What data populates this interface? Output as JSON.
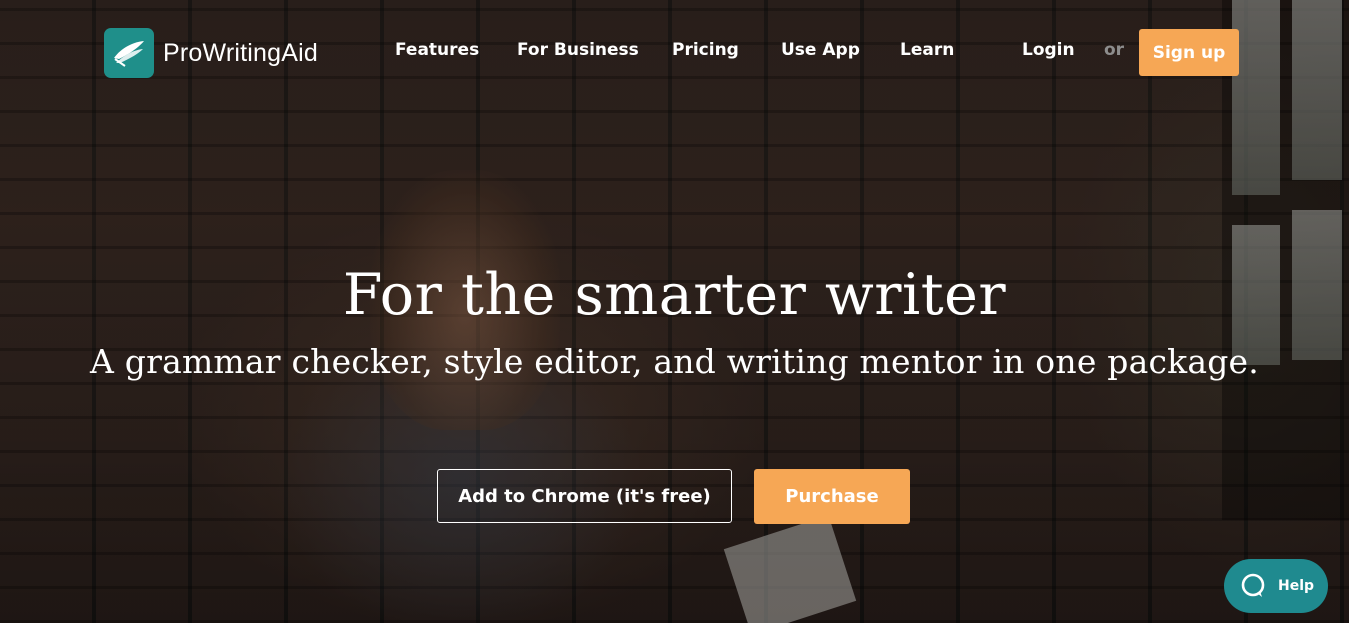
{
  "header": {
    "brand": "ProWritingAid",
    "nav": [
      {
        "label": "Features"
      },
      {
        "label": "For Business"
      },
      {
        "label": "Pricing"
      },
      {
        "label": "Use App"
      },
      {
        "label": "Learn"
      }
    ],
    "login_label": "Login",
    "or_label": "or",
    "signup_label": "Sign up"
  },
  "hero": {
    "headline": "For the smarter writer",
    "subheadline": "A grammar checker, style editor, and writing mentor in one package.",
    "primary_cta": "Add to Chrome (it's free)",
    "secondary_cta": "Purchase"
  },
  "help_widget": {
    "label": "Help",
    "icon": "chat-bubble-icon"
  },
  "colors": {
    "accent_orange": "#f6a755",
    "brand_teal": "#1f8f8a"
  }
}
